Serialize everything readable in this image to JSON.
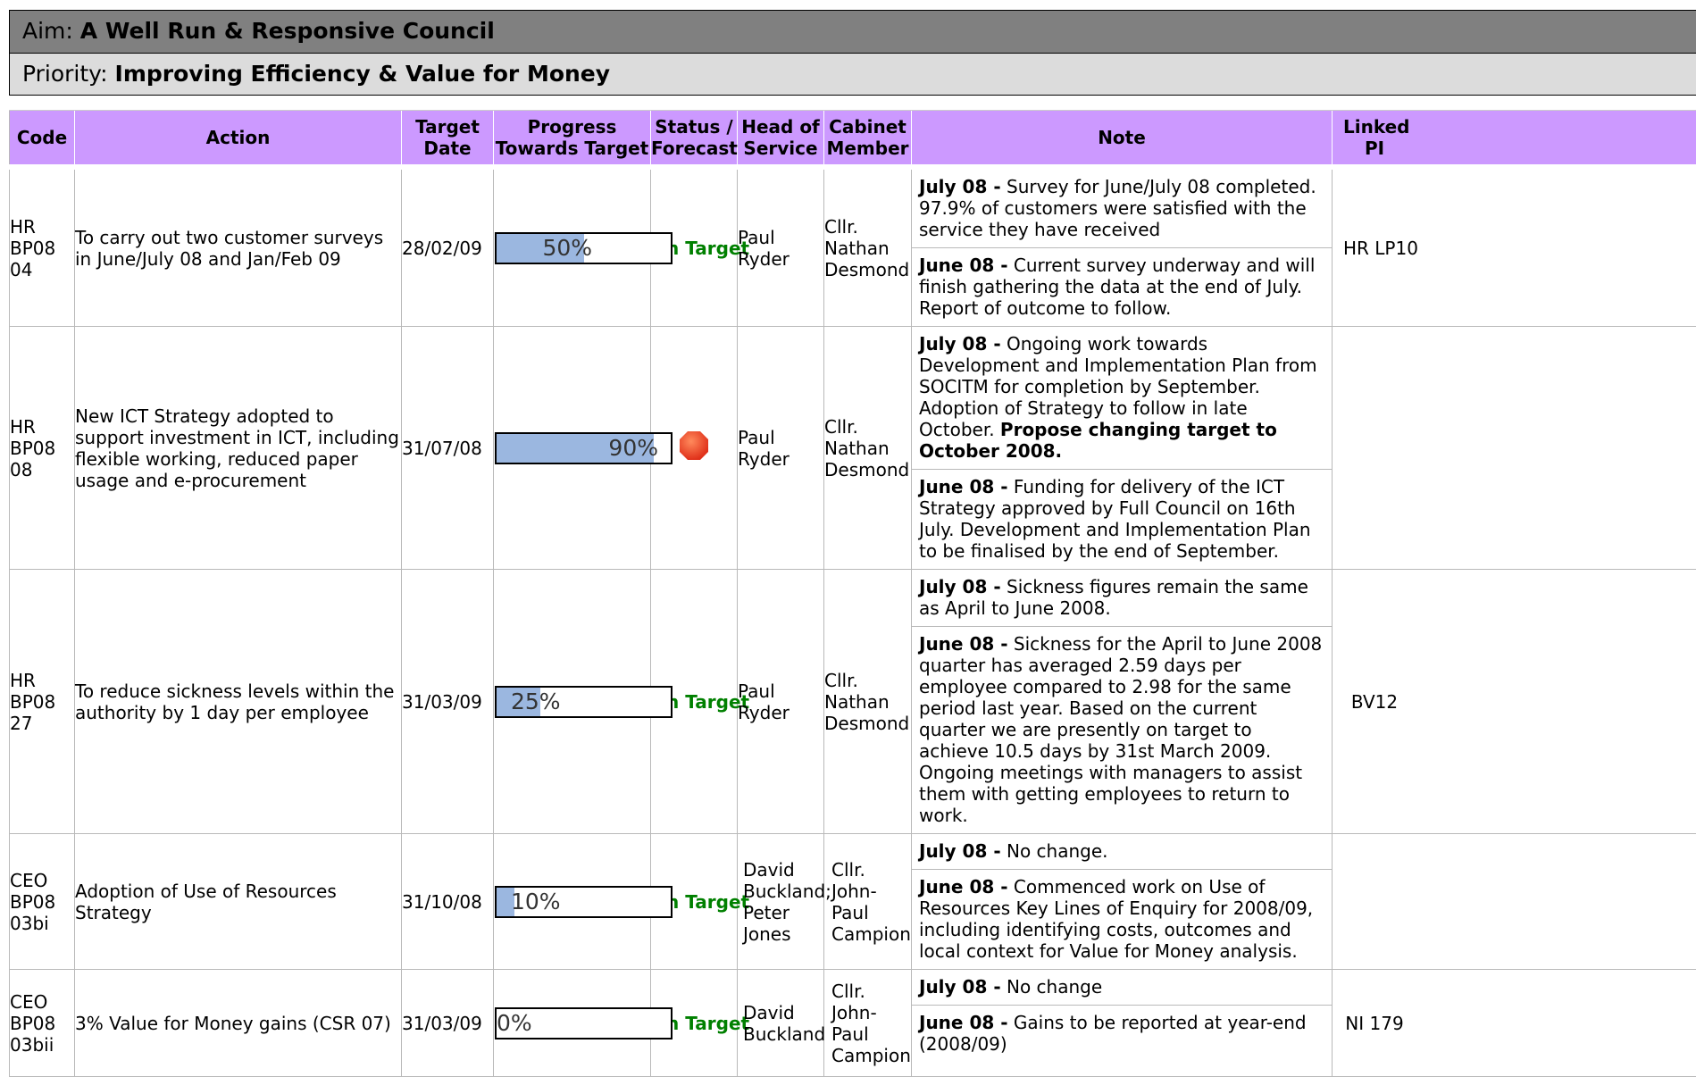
{
  "aim": {
    "label": "Aim:",
    "value": "A Well Run & Responsive Council"
  },
  "priority": {
    "label": "Priority:",
    "value": "Improving Efficiency & Value for Money"
  },
  "columns": {
    "code": "Code",
    "action": "Action",
    "target_date": "Target Date",
    "progress": "Progress Towards Target",
    "status": "Status / Forecast",
    "head": "Head of Service",
    "cabinet": "Cabinet Member",
    "note": "Note",
    "linked_pi": "Linked PI"
  },
  "rows": [
    {
      "code": "HR BP08 04",
      "action": "To carry out two customer surveys in June/July 08 and Jan/Feb 09",
      "target_date": "28/02/09",
      "progress_pct": 50,
      "progress_label": "50%",
      "status": "On Target",
      "head": "Paul Ryder",
      "cabinet": "Cllr. Nathan Desmond",
      "notes": [
        {
          "label": "July 08 -",
          "text": " Survey for June/July 08 completed. 97.9% of customers were satisfied with the service they have received"
        },
        {
          "label": "June 08 -",
          "text": " Current survey underway and will finish gathering the data at the end of July. Report of outcome to follow."
        }
      ],
      "linked_pi": "HR LP10"
    },
    {
      "code": "HR BP08 08",
      "action": "New ICT Strategy adopted to support investment in ICT, including flexible working, reduced paper usage and e-procurement",
      "target_date": "31/07/08",
      "progress_pct": 90,
      "progress_label": "90%",
      "status": "",
      "status_icon": "red-stop-icon",
      "head": "Paul Ryder",
      "cabinet": "Cllr. Nathan Desmond",
      "notes": [
        {
          "label": "July 08 -",
          "text": " Ongoing work towards Development and Implementation Plan from SOCITM for completion by September. Adoption of Strategy to follow in late October. ",
          "bold_tail": "Propose changing target to October 2008."
        },
        {
          "label": "June 08 -",
          "text": " Funding for delivery of the ICT Strategy approved by Full Council on 16th July. Development and Implementation Plan to be finalised by the end of September."
        }
      ],
      "linked_pi": ""
    },
    {
      "code": "HR BP08 27",
      "action": "To reduce sickness levels within the authority by 1 day per employee",
      "target_date": "31/03/09",
      "progress_pct": 25,
      "progress_label": "25%",
      "status": "On Target",
      "head": "Paul Ryder",
      "cabinet": "Cllr. Nathan Desmond",
      "notes": [
        {
          "label": "July 08 -",
          "text": " Sickness figures remain the same as April to June 2008."
        },
        {
          "label": "June 08 -",
          "text": " Sickness for the April to June 2008 quarter has averaged 2.59 days per employee compared to 2.98 for the same period last year. Based on the current quarter we are presently on target to achieve 10.5 days by 31st March 2009.",
          "extra": "Ongoing meetings with managers to assist them with getting employees to return to work."
        }
      ],
      "linked_pi": "BV12"
    },
    {
      "code": "CEO BP08 03bi",
      "action": "Adoption of Use of Resources Strategy",
      "target_date": "31/10/08",
      "progress_pct": 10,
      "progress_label": "10%",
      "status": "On Target",
      "head": "David Buckland; Peter Jones",
      "cabinet": "Cllr. John-Paul Campion",
      "notes": [
        {
          "label": "July 08 -",
          "text": " No change."
        },
        {
          "label": "June 08 -",
          "text": " Commenced work on Use of Resources Key Lines of Enquiry for 2008/09, including identifying costs, outcomes and local context for Value for Money analysis."
        }
      ],
      "linked_pi": ""
    },
    {
      "code": "CEO BP08 03bii",
      "action": "3% Value for Money gains (CSR 07)",
      "target_date": "31/03/09",
      "progress_pct": 0,
      "progress_label": "0%",
      "status": "On Target",
      "head": "David Buckland",
      "cabinet": "Cllr. John-Paul Campion",
      "notes": [
        {
          "label": "July 08 -",
          "text": " No change"
        },
        {
          "label": "June 08 -",
          "text": " Gains to be reported at year-end (2008/09)"
        }
      ],
      "linked_pi": "NI 179"
    }
  ]
}
